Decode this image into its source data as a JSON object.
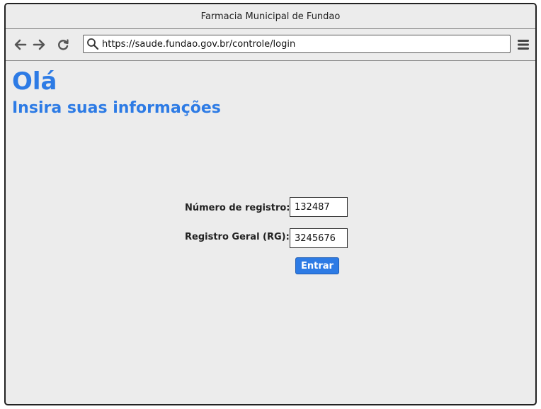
{
  "window": {
    "title": "Farmacia Municipal de Fundao"
  },
  "browser": {
    "url": "https://saude.fundao.gov.br/controle/login",
    "icons": {
      "back": "arrow-left-icon",
      "forward": "arrow-right-icon",
      "reload": "reload-icon",
      "search": "search-icon",
      "menu": "hamburger-menu-icon"
    }
  },
  "page": {
    "greeting": "Olá",
    "subtitle": "Insira suas informações"
  },
  "form": {
    "registration_label": "Número de registro:",
    "registration_value": "132487",
    "rg_label": "Registro Geral (RG):",
    "rg_value": "3245676",
    "submit_label": "Entrar"
  },
  "colors": {
    "accent": "#2d7be5",
    "window_bg": "#ececec"
  }
}
